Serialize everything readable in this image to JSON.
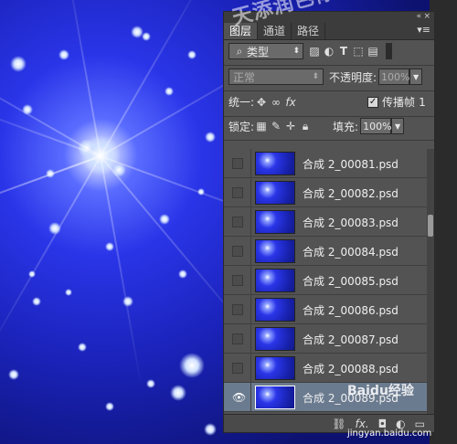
{
  "panel": {
    "tabs": [
      "图层",
      "通道",
      "路径"
    ],
    "active_tab": "图层",
    "top_controls": {
      "collapse": "«",
      "close": "×"
    },
    "menu_icon": "panel-menu-icon"
  },
  "filter": {
    "search_icon": "search-icon",
    "kind_label": "类型",
    "dropdown_arrow": "⬍"
  },
  "blend": {
    "mode": "正常",
    "opacity_label": "不透明度:",
    "opacity_value": "100%"
  },
  "unify": {
    "label": "统一:",
    "propagate_label": "传播帧",
    "propagate_value": "1",
    "propagate_checked": true
  },
  "lock": {
    "label": "锁定:",
    "fill_label": "填充:",
    "fill_value": "100%"
  },
  "layers": [
    {
      "name": "合成 2_00081.psd",
      "visible": false,
      "selected": false
    },
    {
      "name": "合成 2_00082.psd",
      "visible": false,
      "selected": false
    },
    {
      "name": "合成 2_00083.psd",
      "visible": false,
      "selected": false
    },
    {
      "name": "合成 2_00084.psd",
      "visible": false,
      "selected": false
    },
    {
      "name": "合成 2_00085.psd",
      "visible": false,
      "selected": false
    },
    {
      "name": "合成 2_00086.psd",
      "visible": false,
      "selected": false
    },
    {
      "name": "合成 2_00087.psd",
      "visible": false,
      "selected": false
    },
    {
      "name": "合成 2_00088.psd",
      "visible": false,
      "selected": false
    },
    {
      "name": "合成 2_00089.psd",
      "visible": true,
      "selected": true
    }
  ],
  "footer": {
    "link": "⛓",
    "fx": "fx.",
    "mask": "◘",
    "adjust": "◐",
    "folder": "▭"
  },
  "watermark": "天添润色你相约",
  "baidu_text": "Baidu经验",
  "baidu_url": "jingyan.baidu.com",
  "colors": {
    "panel_bg": "#535353",
    "selected_row": "#6b7b8f",
    "canvas_blue": "#2a35e8"
  }
}
